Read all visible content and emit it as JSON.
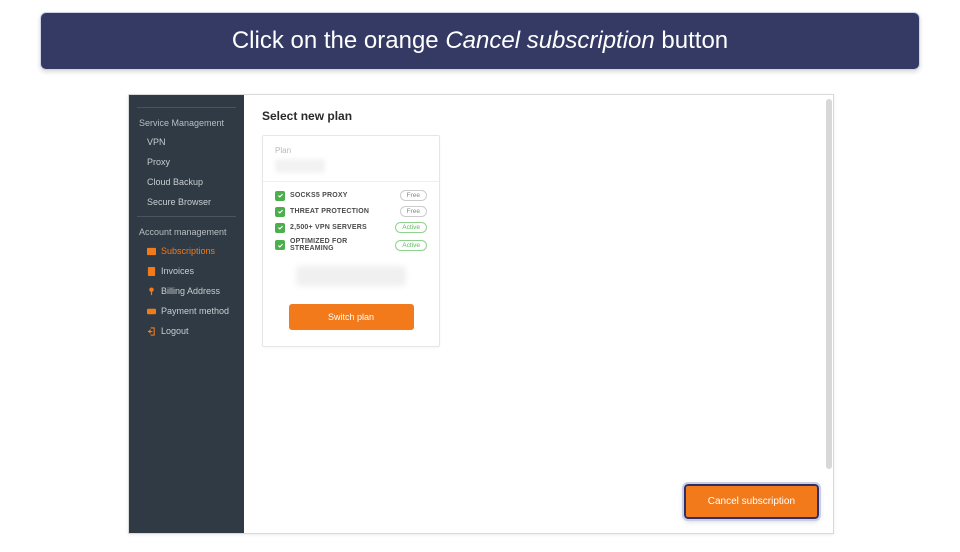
{
  "instruction": {
    "prefix": "Click on the orange ",
    "emphasis": "Cancel subscription",
    "suffix": " button"
  },
  "sidebar": {
    "service_section": "Service Management",
    "service_items": [
      "VPN",
      "Proxy",
      "Cloud Backup",
      "Secure Browser"
    ],
    "account_section": "Account management",
    "account_items": [
      {
        "label": "Subscriptions",
        "icon": "subscriptions-icon",
        "active": true
      },
      {
        "label": "Invoices",
        "icon": "invoices-icon",
        "active": false
      },
      {
        "label": "Billing Address",
        "icon": "billing-icon",
        "active": false
      },
      {
        "label": "Payment method",
        "icon": "payment-icon",
        "active": false
      },
      {
        "label": "Logout",
        "icon": "logout-icon",
        "active": false
      }
    ]
  },
  "main": {
    "title": "Select new plan",
    "plan_label": "Plan",
    "features": [
      {
        "text": "SOCKS5 PROXY",
        "badge": "Free",
        "badge_type": "free"
      },
      {
        "text": "THREAT PROTECTION",
        "badge": "Free",
        "badge_type": "free"
      },
      {
        "text": "2,500+ VPN SERVERS",
        "badge": "Active",
        "badge_type": "active"
      },
      {
        "text": "OPTIMIZED FOR STREAMING",
        "badge": "Active",
        "badge_type": "active"
      }
    ],
    "switch_button": "Switch plan",
    "cancel_button": "Cancel subscription"
  },
  "colors": {
    "accent": "#f27a1a",
    "banner": "#353a64",
    "sidebar": "#2f3a44"
  }
}
